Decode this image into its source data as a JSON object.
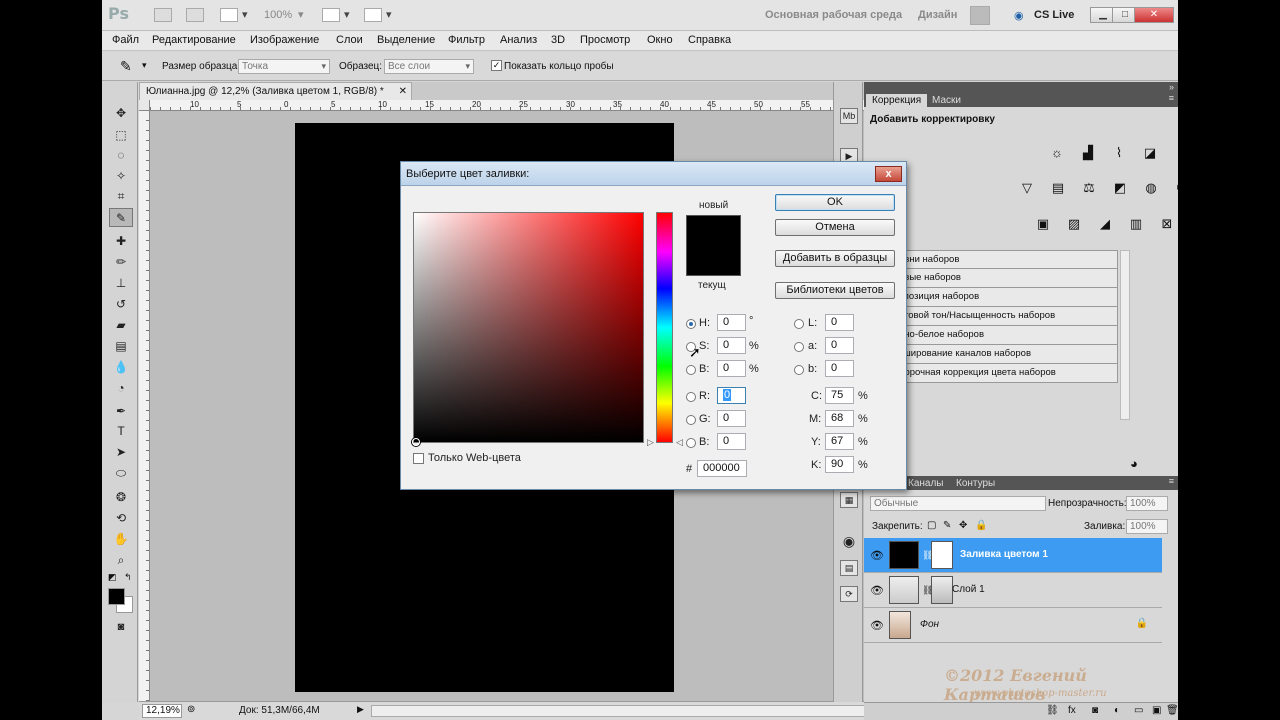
{
  "app": {
    "logo": "Ps",
    "zoom_label": "100%",
    "workspace_essentials": "Основная рабочая среда",
    "workspace_design": "Дизайн",
    "cs_live": "CS Live"
  },
  "menu": [
    "Файл",
    "Редактирование",
    "Изображение",
    "Слои",
    "Выделение",
    "Фильтр",
    "Анализ",
    "3D",
    "Просмотр",
    "Окно",
    "Справка"
  ],
  "options": {
    "sample_size_label": "Размер образца:",
    "sample_size_value": "Точка",
    "sample_label": "Образец:",
    "sample_value": "Все слои",
    "show_ring_label": "Показать кольцо пробы",
    "show_ring_checked": true
  },
  "document": {
    "tab_title": "Юлианна.jpg @ 12,2% (Заливка цветом 1, RGB/8) *",
    "ruler_numbers": [
      "10",
      "5",
      "0",
      "5",
      "10",
      "15",
      "20",
      "25",
      "30",
      "35",
      "40",
      "45",
      "50",
      "55",
      "60",
      "65"
    ],
    "canvas_color": "#000000"
  },
  "status": {
    "zoom": "12,19%",
    "doc_info": "Док: 51,3M/66,4M"
  },
  "panels": {
    "adjust_tab": "Коррекция",
    "masks_tab": "Маски",
    "adjust_title": "Добавить корректировку",
    "presets": [
      "овни наборов",
      "ивые наборов",
      "спозиция наборов",
      "етовой тон/Насыщенность наборов",
      "рно-белое наборов",
      "кширование каналов наборов",
      "борочная коррекция цвета наборов"
    ],
    "channels_tab": "Каналы",
    "paths_tab": "Контуры",
    "blend_mode": "Обычные",
    "opacity_label": "Непрозрачность:",
    "opacity_value": "100%",
    "lock_label": "Закрепить:",
    "fill_label": "Заливка:",
    "fill_value": "100%",
    "layers": [
      {
        "name": "Заливка цветом 1",
        "selected": true
      },
      {
        "name": "Слой 1",
        "selected": false
      },
      {
        "name": "Фон",
        "selected": false
      }
    ]
  },
  "watermark": {
    "line1": "©2012 Евгений Карташов",
    "line2": "www.photoshop-master.ru"
  },
  "dialog": {
    "title": "Выберите цвет заливки:",
    "close": "x",
    "new_label": "новый",
    "current_label": "текущ",
    "ok": "OK",
    "cancel": "Отмена",
    "add_to_swatches": "Добавить в образцы",
    "color_libraries": "Библиотеки цветов",
    "web_only": "Только Web-цвета",
    "hsb": [
      {
        "label": "H:",
        "value": "0",
        "unit": "°"
      },
      {
        "label": "S:",
        "value": "0",
        "unit": "%"
      },
      {
        "label": "B:",
        "value": "0",
        "unit": "%"
      }
    ],
    "rgb": [
      {
        "label": "R:",
        "value": "0"
      },
      {
        "label": "G:",
        "value": "0"
      },
      {
        "label": "B:",
        "value": "0"
      }
    ],
    "lab": [
      {
        "label": "L:",
        "value": "0"
      },
      {
        "label": "a:",
        "value": "0"
      },
      {
        "label": "b:",
        "value": "0"
      }
    ],
    "cmyk": [
      {
        "label": "C:",
        "value": "75",
        "unit": "%"
      },
      {
        "label": "M:",
        "value": "68",
        "unit": "%"
      },
      {
        "label": "Y:",
        "value": "67",
        "unit": "%"
      },
      {
        "label": "K:",
        "value": "90",
        "unit": "%"
      }
    ],
    "hex_label": "#",
    "hex_value": "000000"
  }
}
